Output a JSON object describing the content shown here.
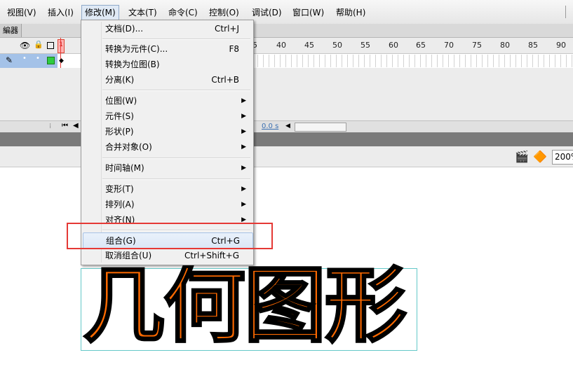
{
  "menubar": {
    "items": [
      "视图(V)",
      "插入(I)",
      "修改(M)",
      "文本(T)",
      "命令(C)",
      "控制(O)",
      "调试(D)",
      "窗口(W)",
      "帮助(H)"
    ],
    "active_index": 2
  },
  "timeline": {
    "tab_label": "編器",
    "current_frame": "1",
    "frame_numbers": [
      "5",
      "40",
      "45",
      "50",
      "55",
      "60",
      "65",
      "70",
      "75",
      "80",
      "85",
      "90"
    ],
    "time_readout": "0.0 s"
  },
  "edit_bar": {
    "zoom_value": "200%"
  },
  "stage": {
    "text": "几何图形",
    "fill_color": "#ff6a00",
    "stroke_color": "#000000"
  },
  "menu": {
    "items": [
      {
        "label": "文档(D)...",
        "shortcut": "Ctrl+J"
      },
      {
        "label": "转换为元件(C)...",
        "shortcut": "F8"
      },
      {
        "label": "转换为位图(B)",
        "shortcut": ""
      },
      {
        "label": "分离(K)",
        "shortcut": "Ctrl+B"
      },
      {
        "label": "位图(W)",
        "shortcut": ""
      },
      {
        "label": "元件(S)",
        "shortcut": ""
      },
      {
        "label": "形状(P)",
        "shortcut": ""
      },
      {
        "label": "合并对象(O)",
        "shortcut": ""
      },
      {
        "label": "时间轴(M)",
        "shortcut": ""
      },
      {
        "label": "变形(T)",
        "shortcut": ""
      },
      {
        "label": "排列(A)",
        "shortcut": ""
      },
      {
        "label": "对齐(N)",
        "shortcut": ""
      },
      {
        "label": "组合(G)",
        "shortcut": "Ctrl+G"
      },
      {
        "label": "取消组合(U)",
        "shortcut": "Ctrl+Shift+G"
      }
    ],
    "highlight_color": "#e53935"
  }
}
